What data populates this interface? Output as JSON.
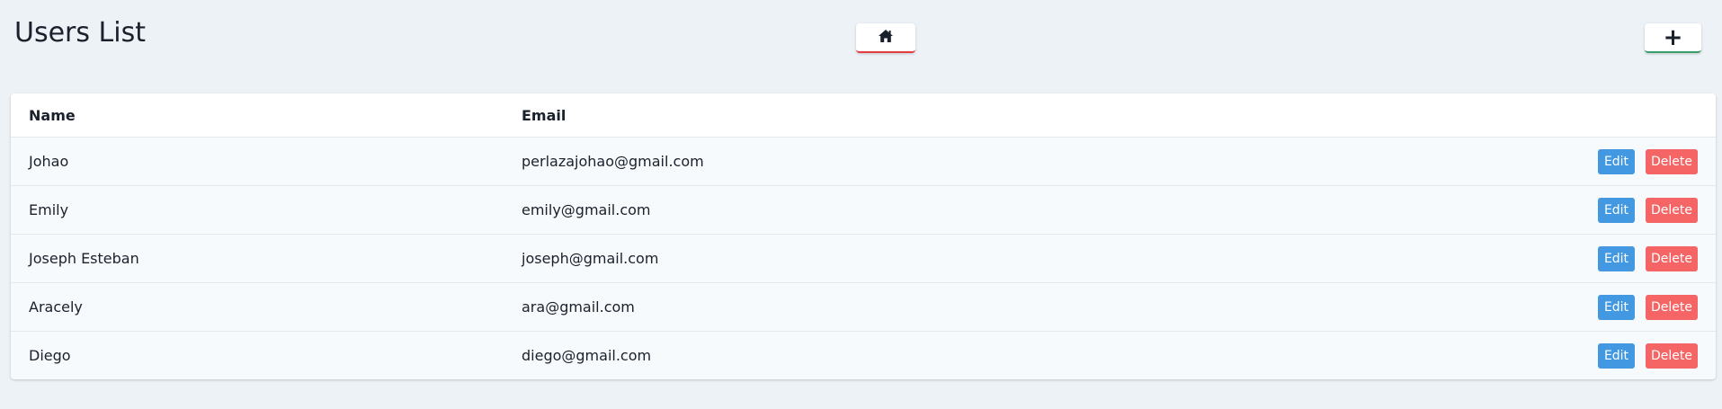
{
  "page": {
    "title": "Users List"
  },
  "toolbar": {
    "home_icon": "home-icon",
    "add_label": "+"
  },
  "table": {
    "headers": {
      "name": "Name",
      "email": "Email"
    },
    "rows": [
      {
        "name": "Johao",
        "email": "perlazajohao@gmail.com",
        "edit": "Edit",
        "delete": "Delete"
      },
      {
        "name": "Emily",
        "email": "emily@gmail.com",
        "edit": "Edit",
        "delete": "Delete"
      },
      {
        "name": "Joseph Esteban",
        "email": "joseph@gmail.com",
        "edit": "Edit",
        "delete": "Delete"
      },
      {
        "name": "Aracely",
        "email": "ara@gmail.com",
        "edit": "Edit",
        "delete": "Delete"
      },
      {
        "name": "Diego",
        "email": "diego@gmail.com",
        "edit": "Edit",
        "delete": "Delete"
      }
    ]
  },
  "colors": {
    "background": "#edf2f7",
    "edit": "#4299e1",
    "delete": "#f56565",
    "home_accent": "#e53e3e",
    "add_accent": "#38a169"
  }
}
